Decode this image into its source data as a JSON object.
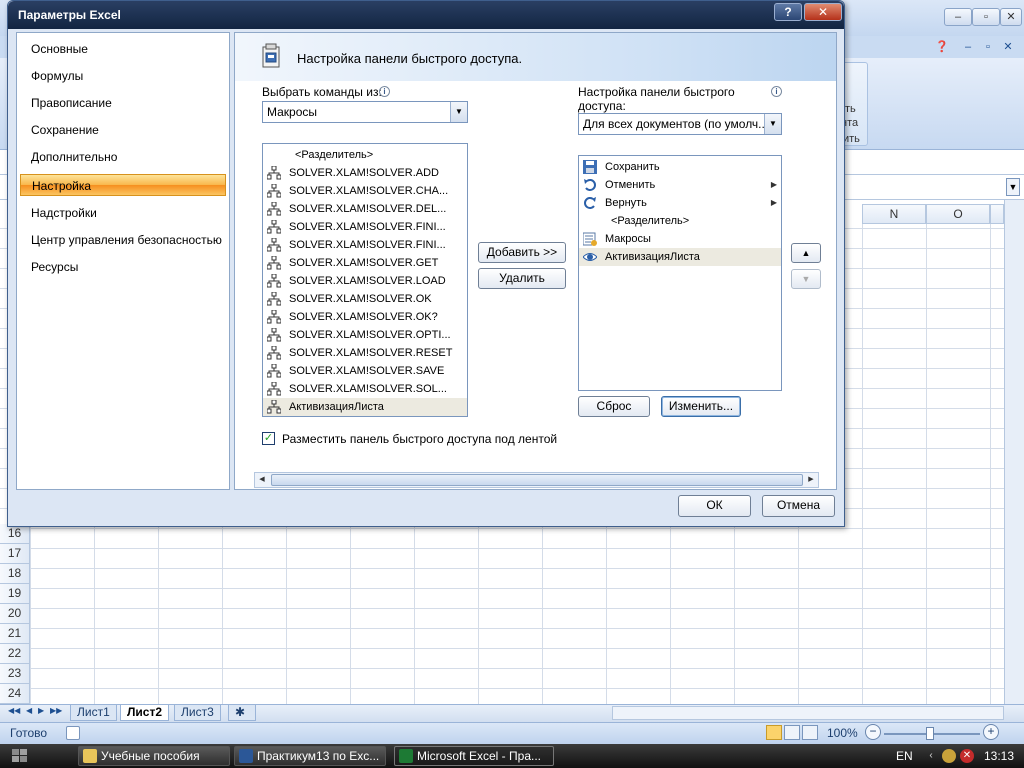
{
  "dialog": {
    "title": "Параметры Excel",
    "help_label": "?",
    "close_label": "✕",
    "nav": [
      {
        "label": "Основные"
      },
      {
        "label": "Формулы"
      },
      {
        "label": "Правописание"
      },
      {
        "label": "Сохранение"
      },
      {
        "label": "Дополнительно"
      },
      {
        "label": "Настройка"
      },
      {
        "label": "Надстройки"
      },
      {
        "label": "Центр управления безопасностью"
      },
      {
        "label": "Ресурсы"
      }
    ],
    "selected_nav": "Настройка",
    "banner_text": "Настройка панели быстрого доступа.",
    "choose_label": "Выбрать команды из:",
    "choose_value": "Макросы",
    "qat_label_line1": "Настройка панели быстрого",
    "qat_label_line2": "доступа:",
    "qat_value": "Для всех документов (по умолч...",
    "commands": [
      "<Разделитель>",
      "SOLVER.XLAM!SOLVER.ADD",
      "SOLVER.XLAM!SOLVER.CHA...",
      "SOLVER.XLAM!SOLVER.DEL...",
      "SOLVER.XLAM!SOLVER.FINI...",
      "SOLVER.XLAM!SOLVER.FINI...",
      "SOLVER.XLAM!SOLVER.GET",
      "SOLVER.XLAM!SOLVER.LOAD",
      "SOLVER.XLAM!SOLVER.OK",
      "SOLVER.XLAM!SOLVER.OK?",
      "SOLVER.XLAM!SOLVER.OPTI...",
      "SOLVER.XLAM!SOLVER.RESET",
      "SOLVER.XLAM!SOLVER.SAVE",
      "SOLVER.XLAM!SOLVER.SOL...",
      "АктивизацияЛиста"
    ],
    "qat_items": [
      {
        "label": "Сохранить",
        "icon": "save-icon"
      },
      {
        "label": "Отменить",
        "icon": "undo-icon"
      },
      {
        "label": "Вернуть",
        "icon": "redo-icon"
      },
      {
        "label": "<Разделитель>",
        "icon": "none"
      },
      {
        "label": "Макросы",
        "icon": "macros-icon"
      },
      {
        "label": "АктивизацияЛиста",
        "icon": "eye-icon"
      }
    ],
    "add_label": "Добавить >>",
    "remove_label": "Удалить",
    "reset_label": "Сброс",
    "modify_label": "Изменить...",
    "checkbox_label": "Разместить панель быстрого доступа под лентой",
    "checkbox_checked": true,
    "ok_label": "ОК",
    "cancel_label": "Отмена"
  },
  "excel": {
    "ribbon_group_line1": "ть",
    "ribbon_group_line2": "нта",
    "ribbon_group_line3": "ить",
    "columns": [
      "N",
      "O"
    ],
    "rows": [
      "16",
      "17",
      "18",
      "19",
      "20",
      "21",
      "22",
      "23",
      "24"
    ],
    "sheets": [
      "Лист1",
      "Лист2",
      "Лист3"
    ],
    "active_sheet": "Лист2",
    "status": "Готово",
    "zoom": "100%",
    "zoom_minus": "−",
    "zoom_plus": "+"
  },
  "taskbar": {
    "tasks": [
      {
        "label": "Учебные пособия"
      },
      {
        "label": "Практикум13 по Exc..."
      },
      {
        "label": "Microsoft Excel - Пра..."
      }
    ],
    "lang": "EN",
    "clock": "13:13"
  },
  "colors": {
    "selected_nav": "#f9b74b",
    "title_bar": "#1b2f50",
    "excel_green": "#1d7a34"
  }
}
